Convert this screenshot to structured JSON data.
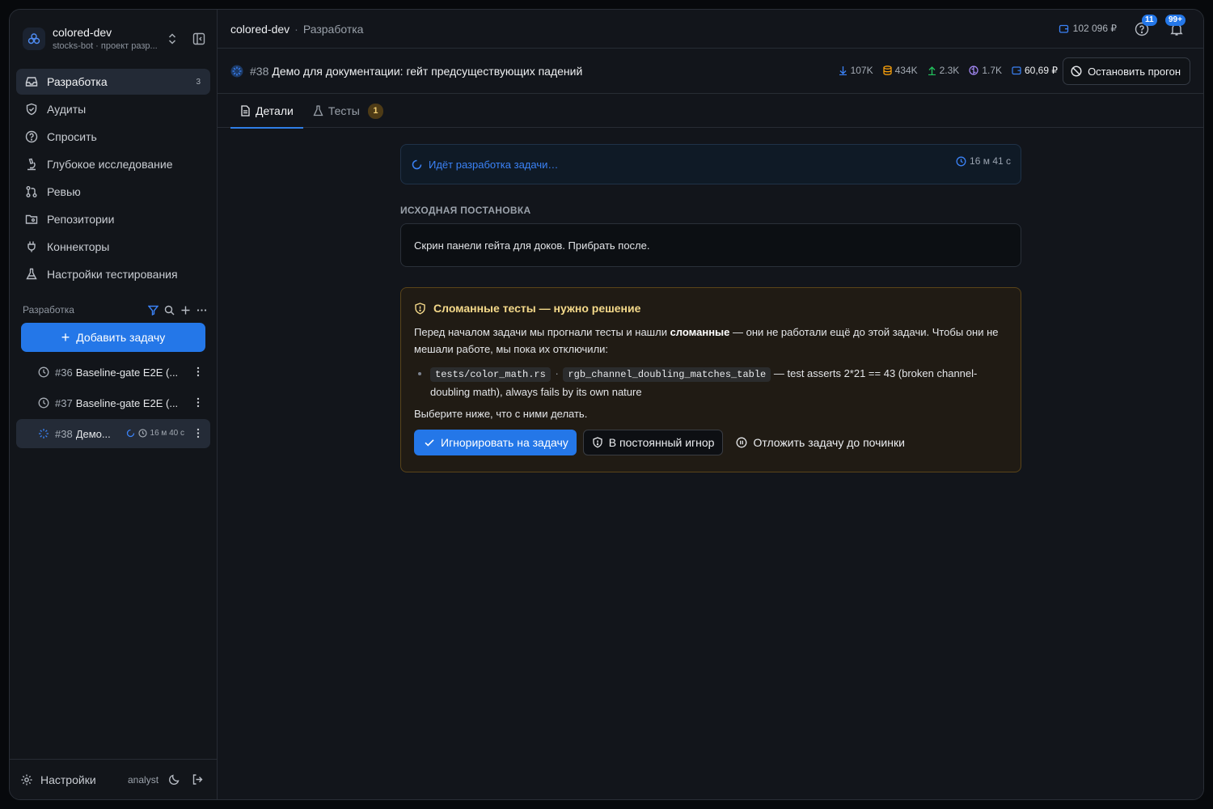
{
  "project": {
    "name": "colored-dev",
    "subtitle": "stocks-bot · проект разр..."
  },
  "sidebar": {
    "nav": [
      {
        "label": "Разработка",
        "count": "3",
        "icon": "inbox-icon"
      },
      {
        "label": "Аудиты",
        "icon": "shield-check-icon"
      },
      {
        "label": "Спросить",
        "icon": "question-circle-icon"
      },
      {
        "label": "Глубокое исследование",
        "icon": "microscope-icon"
      },
      {
        "label": "Ревью",
        "icon": "git-pull-request-icon"
      },
      {
        "label": "Репозитории",
        "icon": "folder-git-icon"
      },
      {
        "label": "Коннекторы",
        "icon": "plug-icon"
      },
      {
        "label": "Настройки тестирования",
        "icon": "flask-icon"
      }
    ],
    "section_label": "Разработка",
    "add_task_label": "Добавить задачу",
    "tasks": [
      {
        "num": "#36",
        "title": "Baseline-gate E2E (...",
        "status": "clock-icon"
      },
      {
        "num": "#37",
        "title": "Baseline-gate E2E (...",
        "status": "clock-icon"
      },
      {
        "num": "#38",
        "title": "Демо...",
        "time": "16 м 40 с",
        "status": "spinner-icon"
      }
    ],
    "footer": {
      "settings_label": "Настройки",
      "user": "analyst"
    }
  },
  "topbar": {
    "crumb_project": "colored-dev",
    "crumb_section": "Разработка",
    "balance": "102 096 ₽",
    "help_badge": "11",
    "notif_badge": "99+"
  },
  "taskbar": {
    "num": "#38",
    "title": "Демо для документации: гейт предсуществующих падений",
    "stats": {
      "download": "107K",
      "db": "434K",
      "upload": "2.3K",
      "brain": "1.7K",
      "cost": "60,69 ₽"
    },
    "stop_label": "Остановить прогон"
  },
  "tabs": [
    {
      "label": "Детали",
      "icon": "document-icon"
    },
    {
      "label": "Тесты",
      "icon": "flask-icon",
      "badge": "1"
    }
  ],
  "progress": {
    "text": "Идёт разработка задачи…",
    "time": "16 м 41 с"
  },
  "original": {
    "title": "Исходная постановка",
    "text": "Скрин панели гейта для доков. Прибрать после."
  },
  "warning": {
    "title": "Сломанные тесты — нужно решение",
    "intro_before": "Перед началом задачи мы прогнали тесты и нашли ",
    "intro_bold": "сломанные",
    "intro_after": " — они не работали ещё до этой задачи. Чтобы они не мешали работе, мы пока их отключили:",
    "test_file": "tests/color_math.rs",
    "test_sep": "·",
    "test_name": "rgb_channel_doubling_matches_table",
    "test_desc": " — test asserts 2*21 == 43 (broken channel-doubling math), always fails by its own nature",
    "ask": "Выберите ниже, что с ними делать.",
    "btn_ignore_task": "Игнорировать на задачу",
    "btn_ignore_forever": "В постоянный игнор",
    "btn_postpone": "Отложить задачу до починки"
  },
  "colors": {
    "accent": "#2477e8",
    "warn": "#f4d98a",
    "bg": "#12151b"
  }
}
